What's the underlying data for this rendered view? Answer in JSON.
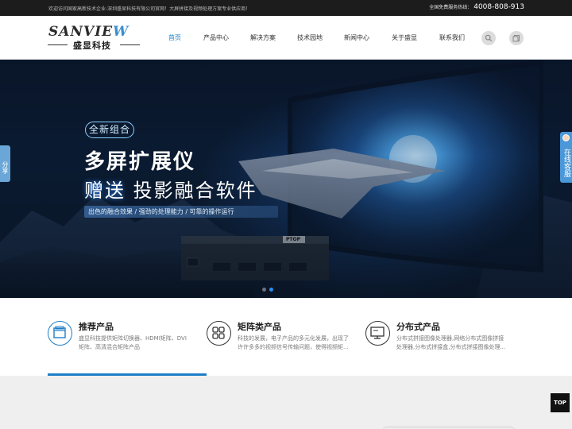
{
  "topbar": {
    "welcome": "欢迎访问国家高新技术企业-深圳盛显科技有限公司官网！大屏拼接及视频处理方案专业供应商！",
    "hotline_label": "全国免费服务热线：",
    "hotline_number": "4008-808-913"
  },
  "logo": {
    "brand_left": "SANVIE",
    "brand_right": "W",
    "chinese": "盛显科技"
  },
  "nav": {
    "items": [
      {
        "label": "首页",
        "active": true
      },
      {
        "label": "产品中心",
        "active": false
      },
      {
        "label": "解决方案",
        "active": false
      },
      {
        "label": "技术园地",
        "active": false
      },
      {
        "label": "新闻中心",
        "active": false
      },
      {
        "label": "关于盛显",
        "active": false
      },
      {
        "label": "联系我们",
        "active": false
      }
    ],
    "icons": [
      "search-icon",
      "cart-icon"
    ]
  },
  "banner": {
    "tag": "全新组合",
    "headline": "多屏扩展仪",
    "subhead_highlight": "赠送",
    "subhead_rest": "投影融合软件",
    "tagline": "出色的融合效果 / 强劲的处理能力 / 可靠的操作运行",
    "device_brand": "PTOP",
    "slide_count": 2,
    "active_slide": 2
  },
  "float": {
    "share": "分享",
    "customer_service": "在线客服"
  },
  "features": [
    {
      "title": "推荐产品",
      "desc": "盛显科技提供矩阵切换器、HDMI矩阵、DVI矩阵、高清混合矩阵产品",
      "icon": "window-icon"
    },
    {
      "title": "矩阵类产品",
      "desc": "科技的发展，电子产品的多元化发展，出现了许许多多的视频信号传输问题，使得视频矩...",
      "icon": "grid-icon"
    },
    {
      "title": "分布式产品",
      "desc": "分布式拼接图像处理器,网络分布式图像拼接处理器,分布式拼接盒,分布式拼接图像处理...",
      "icon": "monitor-icon"
    }
  ],
  "back_to_top": "TOP",
  "colors": {
    "accent": "#1e7fc8",
    "topbar": "#1c1c1c",
    "banner_bg": "#081629"
  }
}
